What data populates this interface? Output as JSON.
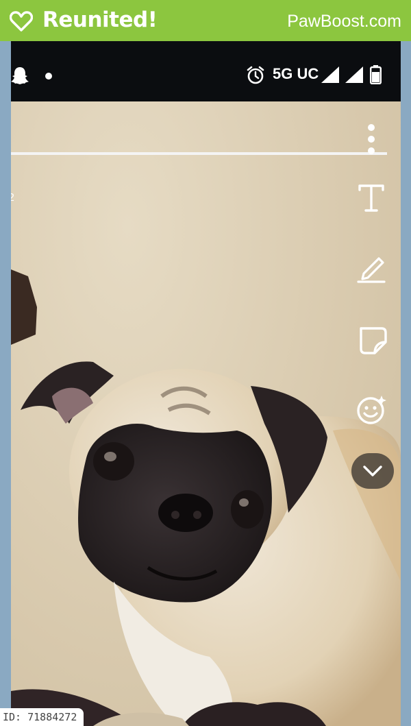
{
  "banner": {
    "status": "Reunited!",
    "brand": "PawBoost.com",
    "color": "#8cc63f"
  },
  "statusbar": {
    "network": "5G UC"
  },
  "photo": {
    "edge_mark": "2"
  },
  "tools": [
    "more-options-icon",
    "text-tool-icon",
    "pen-tool-icon",
    "sticker-tool-icon",
    "emoji-lens-icon",
    "chevron-down-icon"
  ],
  "listing": {
    "id_label": "ID: 71884272"
  }
}
